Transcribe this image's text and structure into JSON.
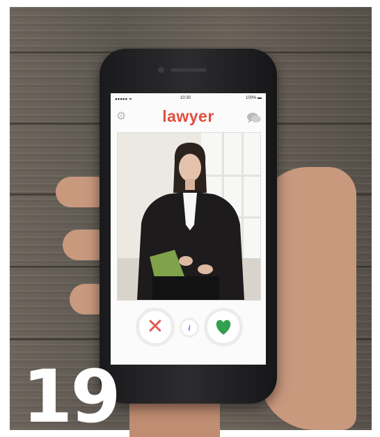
{
  "status_bar": {
    "carrier": "●●●●● ᯤ",
    "time": "10:30",
    "battery": "100% ▬"
  },
  "app": {
    "logo_text": "lawyer",
    "brand_color": "#e14e3f"
  },
  "icons": {
    "settings": "gear-icon",
    "messages": "chat-bubbles-icon",
    "dislike": "close-icon",
    "info": "info-icon",
    "like": "heart-icon"
  },
  "actions": {
    "dislike_symbol": "✕",
    "info_symbol": "i"
  },
  "overlay": {
    "number": "19"
  }
}
